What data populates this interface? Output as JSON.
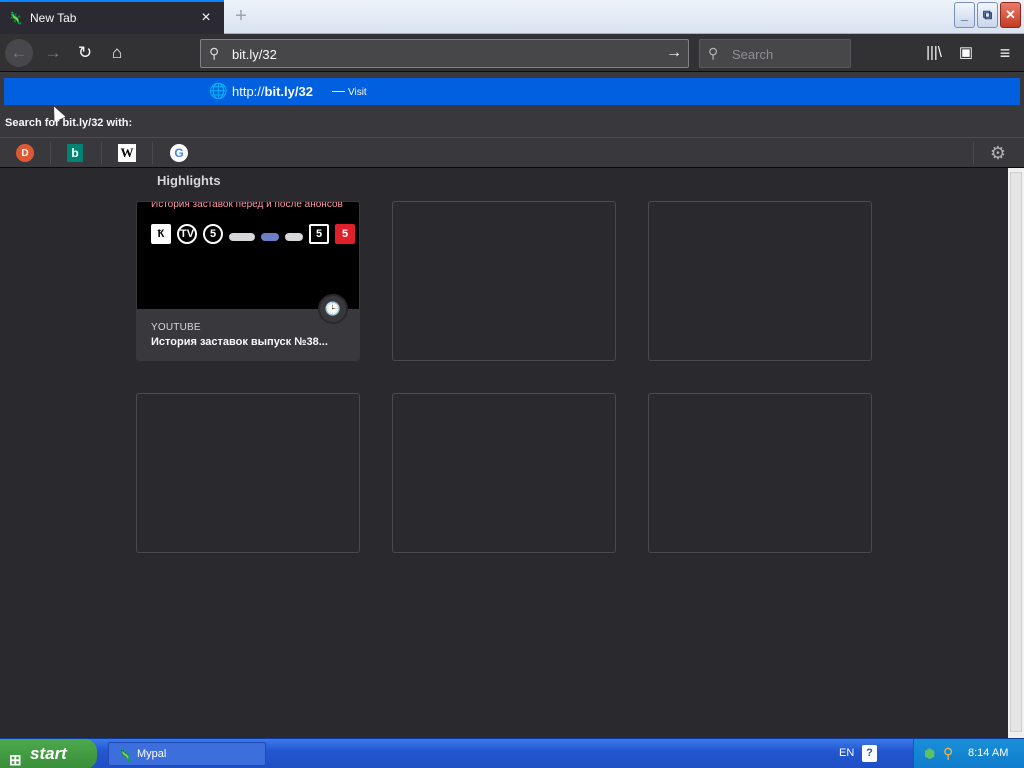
{
  "tab": {
    "title": "New Tab",
    "favicon": "mypal-icon",
    "close": "×"
  },
  "new_tab": "+",
  "window_buttons": {
    "minimize": "_",
    "maximize": "⧉",
    "close": "✕"
  },
  "nav": {
    "back": "←",
    "forward": "→",
    "reload": "↻",
    "home": "⌂"
  },
  "urlbar": {
    "value": "bit.ly/32",
    "search_glyph": "⚲",
    "go": "→"
  },
  "search": {
    "placeholder": "Search",
    "glyph": "⚲"
  },
  "toolbar_right": {
    "library": "|||\\",
    "sidebar": "▣",
    "menu": "≡"
  },
  "popup": {
    "result_url_prefix": "http://",
    "result_url_bold": "bit.ly/32",
    "result_sep": "—",
    "result_action": "Visit",
    "search_with": "Search for bit.ly/32 with:",
    "engines": [
      {
        "name": "duckduckgo-icon",
        "glyph": "D"
      },
      {
        "name": "bing-icon",
        "glyph": "b"
      },
      {
        "name": "wikipedia-icon",
        "glyph": "W"
      },
      {
        "name": "google-icon",
        "glyph": "G"
      }
    ],
    "settings_glyph": "⚙"
  },
  "highlights": {
    "title": "Highlights",
    "cards": [
      {
        "thumb_caption": "История заставок перед и после анонсов",
        "source": "YOUTUBE",
        "title": "История заставок выпуск №38...",
        "logos": [
          "Ҟ",
          "TV",
          "5",
          "",
          "",
          "",
          "5",
          "5"
        ]
      }
    ]
  },
  "taskbar": {
    "start": "start",
    "task_label": "Mypal",
    "lang": "EN",
    "help": "?",
    "time": "8:14 AM"
  },
  "colors": {
    "accent": "#0060df",
    "bg": "#2a2a2e",
    "taskbar": "#2457d0"
  }
}
